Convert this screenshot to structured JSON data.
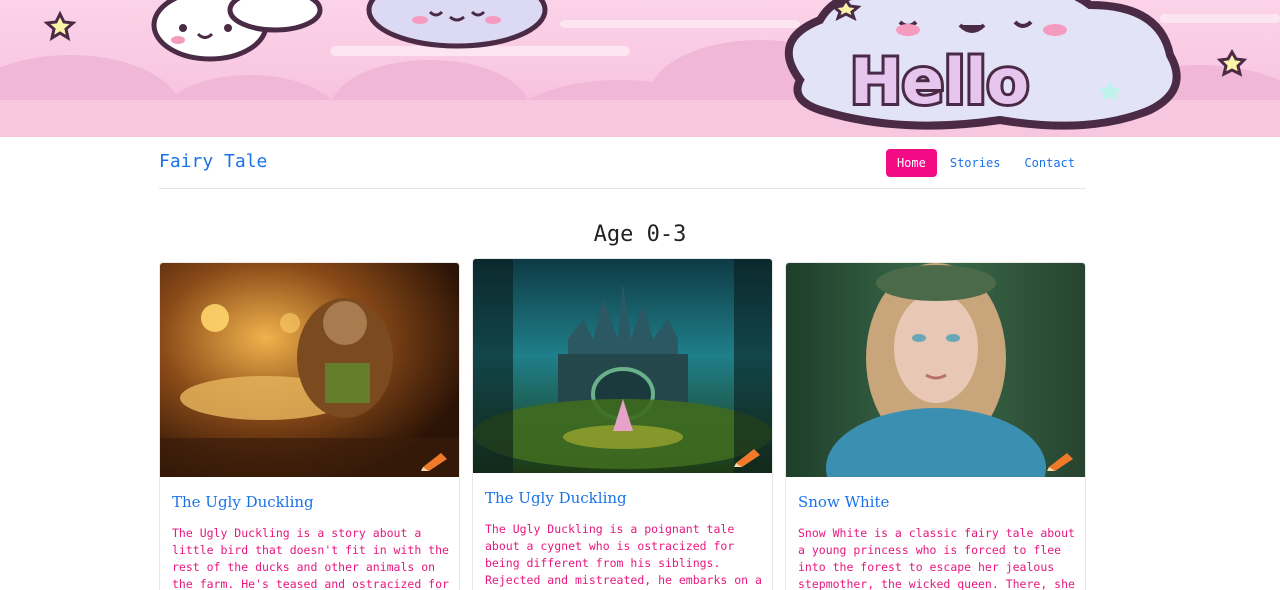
{
  "banner": {
    "hello_text": "Hello"
  },
  "navbar": {
    "brand": "Fairy Tale",
    "items": [
      {
        "label": "Home",
        "active": true
      },
      {
        "label": "Stories",
        "active": false
      },
      {
        "label": "Contact",
        "active": false
      }
    ]
  },
  "section": {
    "title": "Age 0-3"
  },
  "cards": [
    {
      "title": "The Ugly Duckling",
      "text": "The Ugly Duckling is a story about a little bird that doesn't fit in with the rest of the ducks and other animals on the farm. He's teased and ostracized for"
    },
    {
      "title": "The Ugly Duckling",
      "text": "The Ugly Duckling is a poignant tale about a cygnet who is ostracized for being different from his siblings. Rejected and mistreated, he embarks on a"
    },
    {
      "title": "Snow White",
      "text": "Snow White is a classic fairy tale about a young princess who is forced to flee into the forest to escape her jealous stepmother, the wicked queen. There, she"
    }
  ],
  "colors": {
    "accent": "#f30a85",
    "link": "#1a73e8",
    "body_text": "#e8177f"
  }
}
